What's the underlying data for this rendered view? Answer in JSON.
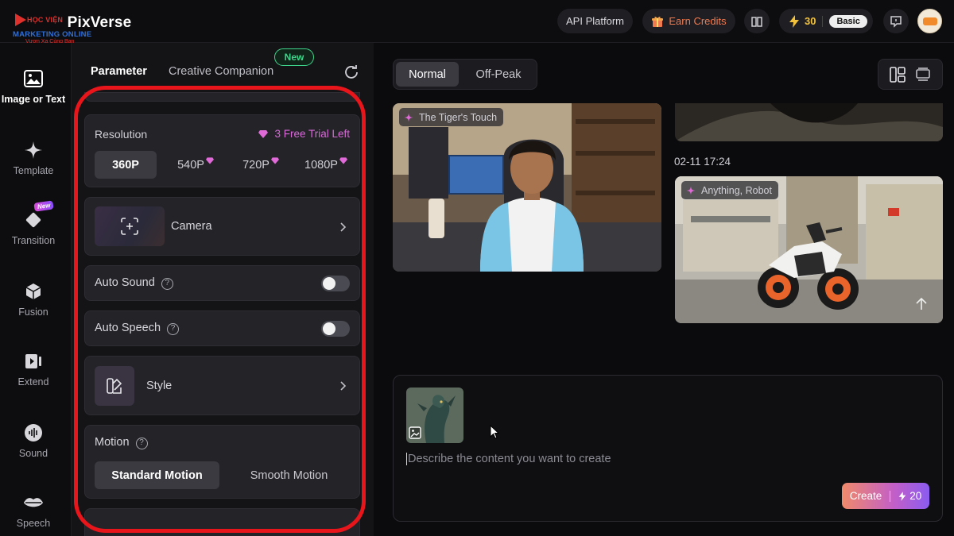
{
  "logo": {
    "brand_prefix": "HỌC VIỆN",
    "brand_name": "PixVerse",
    "subtitle": "MARKETING ONLINE",
    "tagline": "Vươn Xa Cùng Bạn"
  },
  "topbar": {
    "api_platform": "API Platform",
    "earn_credits": "Earn Credits",
    "credits": "30",
    "plan": "Basic"
  },
  "leftnav": {
    "items": [
      {
        "label": "Image or Text",
        "icon": "image-icon",
        "active": true
      },
      {
        "label": "Template",
        "icon": "sparkle-icon"
      },
      {
        "label": "Transition",
        "icon": "transition-icon",
        "badge": "New"
      },
      {
        "label": "Fusion",
        "icon": "cube-icon"
      },
      {
        "label": "Extend",
        "icon": "extend-icon"
      },
      {
        "label": "Sound",
        "icon": "sound-icon"
      },
      {
        "label": "Speech",
        "icon": "lips-icon"
      }
    ]
  },
  "panel": {
    "tab_parameter": "Parameter",
    "tab_creative": "Creative Companion",
    "new_badge": "New",
    "resolution": {
      "title": "Resolution",
      "trial_text": "3 Free Trial Left",
      "options": [
        "360P",
        "540P",
        "720P",
        "1080P"
      ],
      "selected": "360P"
    },
    "camera": "Camera",
    "auto_sound": "Auto Sound",
    "auto_speech": "Auto Speech",
    "style": "Style",
    "motion": {
      "title": "Motion",
      "options": [
        "Standard Motion",
        "Smooth Motion"
      ],
      "selected": "Standard Motion"
    }
  },
  "main": {
    "modes": [
      "Normal",
      "Off-Peak"
    ],
    "mode_selected": "Normal",
    "video1_tag": "The Tiger's Touch",
    "timestamp": "02-11 17:24",
    "video3_tag": "Anything, Robot",
    "prompt_placeholder": "Describe the content you want to create",
    "create_label": "Create",
    "create_cost": "20"
  },
  "colors": {
    "accent_pink": "#d86ad8",
    "new_green": "#3fd48b",
    "credit_yellow": "#f3c23c",
    "highlight_red": "#e8161b"
  }
}
